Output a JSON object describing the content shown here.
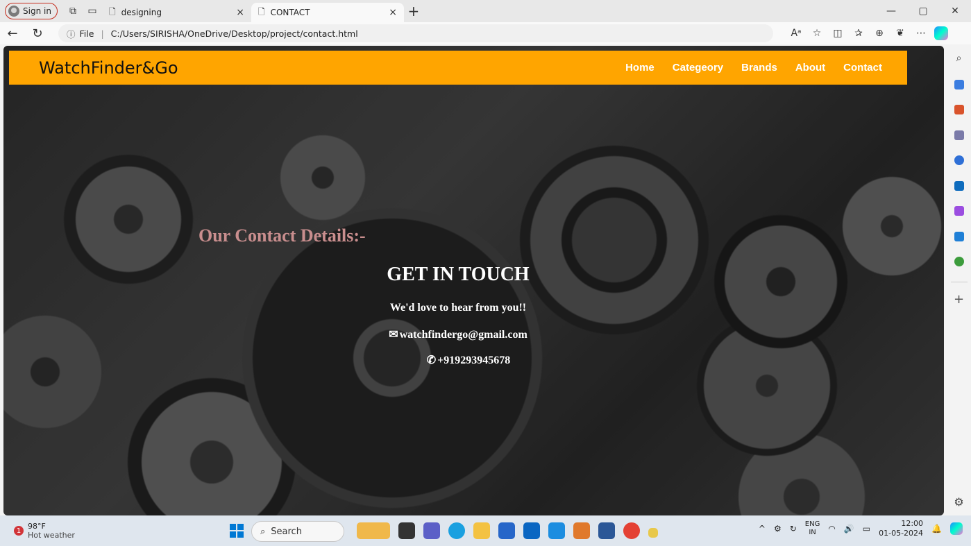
{
  "browser": {
    "profile_label": "Sign in",
    "tabs": [
      {
        "title": "designing",
        "close": "×"
      },
      {
        "title": "CONTACT",
        "close": "×"
      }
    ],
    "new_tab": "+",
    "window_controls": {
      "minimize": "—",
      "restore": "▢",
      "close": "✕"
    },
    "address": {
      "prefix": "File",
      "url": "C:/Users/SIRISHA/OneDrive/Desktop/project/contact.html"
    }
  },
  "site": {
    "brand": "WatchFinder&Go",
    "nav": [
      "Home",
      "Categeory",
      "Brands",
      "About",
      "Contact"
    ],
    "accent_color": "#ffa500",
    "heading": "Our Contact Details:-",
    "title": "GET IN TOUCH",
    "tagline": "We'd love to hear from you!!",
    "email": "watchfindergo@gmail.com",
    "phone": "+919293945678"
  },
  "taskbar": {
    "weather_temp": "98°F",
    "weather_desc": "Hot weather",
    "weather_badge": "1",
    "search_placeholder": "Search",
    "lang_top": "ENG",
    "lang_bottom": "IN",
    "time": "12:00",
    "date": "01-05-2024"
  }
}
